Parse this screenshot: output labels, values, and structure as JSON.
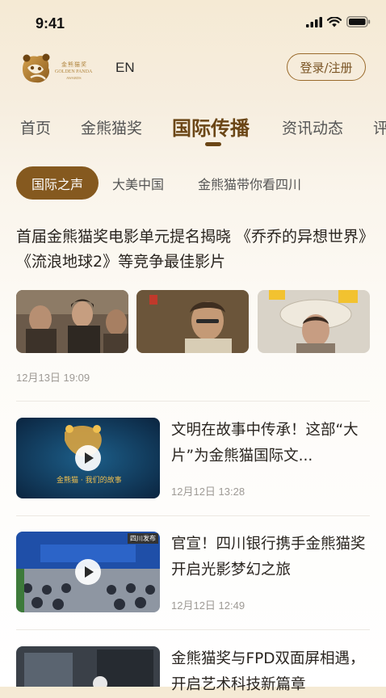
{
  "status_bar": {
    "time": "9:41"
  },
  "header": {
    "logo_text_cn": "金熊猫奖",
    "logo_text_en": "GOLDEN PANDA",
    "logo_text_sub": "AWARDS",
    "language": "EN",
    "login_label": "登录/注册"
  },
  "main_tabs": [
    {
      "label": "首页"
    },
    {
      "label": "金熊猫奖"
    },
    {
      "label": "国际传播",
      "active": true
    },
    {
      "label": "资讯动态"
    },
    {
      "label": "评"
    }
  ],
  "sub_tabs": [
    {
      "label": "国际之声",
      "active": true
    },
    {
      "label": "大美中国"
    },
    {
      "label": "金熊猫带你看四川"
    }
  ],
  "featured": {
    "title": "首届金熊猫奖电影单元提名揭晓 《乔乔的异想世界》《流浪地球2》等竞争最佳影片",
    "date": "12月13日 19:09"
  },
  "articles": [
    {
      "title": "文明在故事中传承！这部“大片”为金熊猫国际文...",
      "date": "12月12日 13:28",
      "thumb_caption": "金熊猫 · 我们的故事",
      "has_video": true
    },
    {
      "title": "官宣！四川银行携手金熊猫奖 开启光影梦幻之旅",
      "date": "12月12日 12:49",
      "thumb_badge": "四川发布",
      "has_video": true
    },
    {
      "title": "金熊猫奖与FPD双面屏相遇，开启艺术科技新篇章",
      "date": "",
      "has_video": false
    }
  ],
  "colors": {
    "brand_brown": "#85591f",
    "active_tab": "#6b4616",
    "meta_gray": "#9e9a95"
  }
}
